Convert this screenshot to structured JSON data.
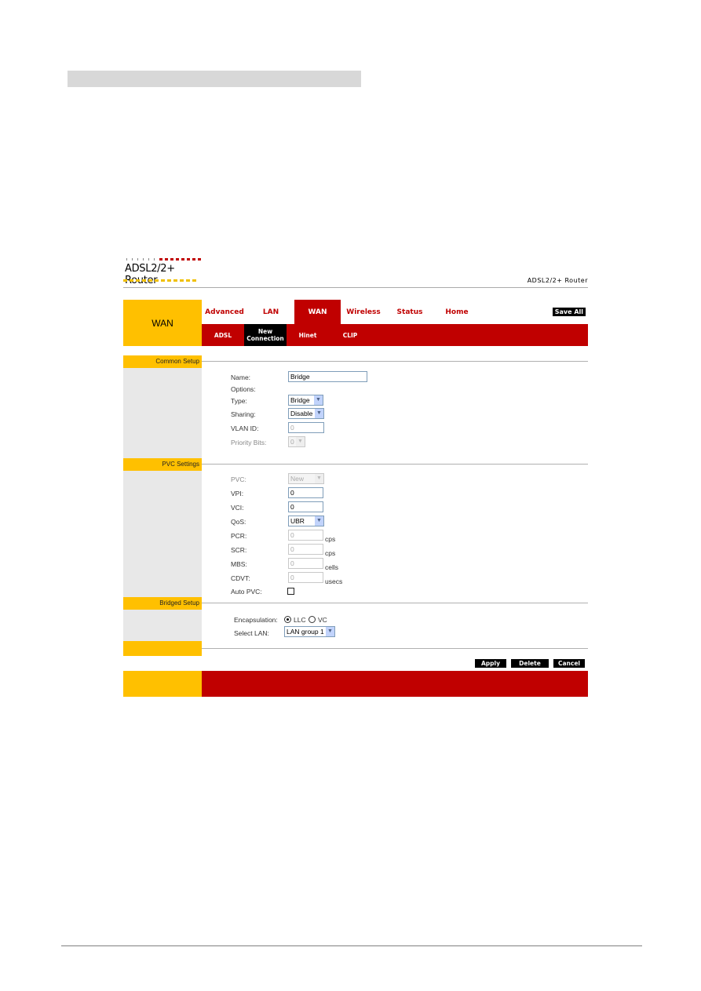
{
  "document": {
    "heading_bar_text": ""
  },
  "router": {
    "logo_text": "ADSL2/2+ Router",
    "product_name": "ADSL2/2+ Router",
    "side_title": "WAN",
    "main_nav": [
      {
        "label": "Advanced",
        "active": false
      },
      {
        "label": "LAN",
        "active": false
      },
      {
        "label": "WAN",
        "active": true
      },
      {
        "label": "Wireless",
        "active": false
      },
      {
        "label": "Status",
        "active": false
      },
      {
        "label": "Home",
        "active": false
      }
    ],
    "save_all_label": "Save All",
    "sub_nav": [
      {
        "label": "ADSL",
        "active": false
      },
      {
        "label": "New Connection",
        "active": true
      },
      {
        "label": "Hinet",
        "active": false
      },
      {
        "label": "CLIP",
        "active": false
      }
    ],
    "common_setup": {
      "title": "Common Setup",
      "name_label": "Name:",
      "name_value": "Bridge",
      "options_label": "Options:",
      "type_label": "Type:",
      "type_value": "Bridge",
      "sharing_label": "Sharing:",
      "sharing_value": "Disable",
      "vlan_id_label": "VLAN ID:",
      "vlan_id_value": "0",
      "priority_bits_label": "Priority Bits:",
      "priority_bits_value": "0"
    },
    "pvc_settings": {
      "title": "PVC Settings",
      "pvc_label": "PVC:",
      "pvc_value": "New",
      "vpi_label": "VPI:",
      "vpi_value": "0",
      "vci_label": "VCI:",
      "vci_value": "0",
      "qos_label": "QoS:",
      "qos_value": "UBR",
      "pcr_label": "PCR:",
      "pcr_value": "0",
      "pcr_unit": "cps",
      "scr_label": "SCR:",
      "scr_value": "0",
      "scr_unit": "cps",
      "mbs_label": "MBS:",
      "mbs_value": "0",
      "mbs_unit": "cells",
      "cdvt_label": "CDVT:",
      "cdvt_value": "0",
      "cdvt_unit": "usecs",
      "auto_pvc_label": "Auto PVC:",
      "auto_pvc_checked": false
    },
    "bridged_setup": {
      "title": "Bridged Setup",
      "encapsulation_label": "Encapsulation:",
      "encapsulation_options": [
        "LLC",
        "VC"
      ],
      "encapsulation_selected": "LLC",
      "select_lan_label": "Select LAN:",
      "select_lan_value": "LAN group 1"
    },
    "actions": {
      "apply": "Apply",
      "delete": "Delete",
      "cancel": "Cancel"
    },
    "colors": {
      "brand_red": "#c00000",
      "brand_yellow": "#ffc000",
      "side_gray": "#e8e8e8"
    }
  }
}
